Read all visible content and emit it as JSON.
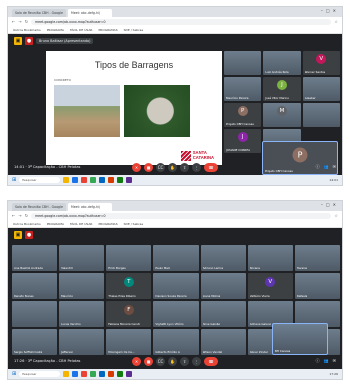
{
  "top": {
    "tabs": [
      "Sala de Reunião CBH - Google",
      "Meet: abc-defg-hij"
    ],
    "url": "meet.google.com/ab-xxxx-mop?authuser=0",
    "bookmarks": [
      "Outros Bookmarks",
      "PROGRAMA",
      "FÁCIL DE USAR",
      "PROGRAMAS",
      "SDE / Sebrae"
    ],
    "meet_header": "Bruno Baltisar (Apresentando)",
    "slide": {
      "title": "Tipos de Barragens",
      "caption": "CONCRETO",
      "brand_line1": "SANTA",
      "brand_line2": "CATARINA"
    },
    "participants": [
      {
        "initial": "",
        "name": "",
        "color": "#5f6368",
        "camera": true
      },
      {
        "initial": "",
        "name": "Luiz Andréa Rola",
        "color": "#5f6368",
        "camera": true
      },
      {
        "initial": "V",
        "name": "Werner Santos",
        "color": "#c2185b",
        "camera": false
      },
      {
        "initial": "",
        "name": "Maurício Pereira",
        "color": "#5f6368",
        "camera": true
      },
      {
        "initial": "J",
        "name": "José Vitor Marino",
        "color": "#7cb342",
        "camera": false
      },
      {
        "initial": "",
        "name": "Gleeber",
        "color": "#5f6368",
        "camera": true
      },
      {
        "initial": "P",
        "name": "Projeto CBH Canoas",
        "color": "#8d6e63",
        "camera": false
      },
      {
        "initial": "M",
        "name": "",
        "color": "#5f6368",
        "camera": true
      },
      {
        "initial": "",
        "name": "",
        "color": "#5f6368",
        "camera": true
      },
      {
        "initial": "J",
        "name": "JOSIANE CORREA",
        "color": "#8e24aa",
        "camera": false
      },
      {
        "initial": "",
        "name": "",
        "color": "#5f6368",
        "camera": true
      }
    ],
    "self_tile": {
      "initial": "P",
      "name": "Projeto CBH Canoas",
      "color": "#8d6e63"
    },
    "footer_time": "14:01 · 3ª Capacitação - CBH Pelotas"
  },
  "bottom": {
    "tabs": [
      "Sala de Reunião CBH - Google",
      "Meet: abc-defg-hij"
    ],
    "url": "meet.google.com/ab-xxxx-mop?authuser=0",
    "bookmarks": [
      "Outros Bookmarks",
      "PROGRAMA",
      "FÁCIL DE USAR",
      "PROGRAMAS",
      "SDE / Sebrae"
    ],
    "participants": [
      {
        "initial": "",
        "name": "Ana Beatriz Andrade",
        "color": "#5f6368",
        "camera": true
      },
      {
        "initial": "",
        "name": "Valentim",
        "color": "#5f6368",
        "camera": true
      },
      {
        "initial": "",
        "name": "Erick Borges",
        "color": "#5f6368",
        "camera": true
      },
      {
        "initial": "",
        "name": "Paulo Melo",
        "color": "#5f6368",
        "camera": true
      },
      {
        "initial": "",
        "name": "Adriano Lemos",
        "color": "#5f6368",
        "camera": true
      },
      {
        "initial": "",
        "name": "Silvana",
        "color": "#5f6368",
        "camera": true
      },
      {
        "initial": "",
        "name": "Tavares",
        "color": "#5f6368",
        "camera": true
      },
      {
        "initial": "",
        "name": "Renato Nunes",
        "color": "#5f6368",
        "camera": true
      },
      {
        "initial": "",
        "name": "Maurício",
        "color": "#5f6368",
        "camera": true
      },
      {
        "initial": "T",
        "name": "Thales Pires Ribeiro",
        "color": "#00897b",
        "camera": false
      },
      {
        "initial": "",
        "name": "Davison Souza Pereira",
        "color": "#5f6368",
        "camera": true
      },
      {
        "initial": "",
        "name": "Joana Molina",
        "color": "#5f6368",
        "camera": true
      },
      {
        "initial": "V",
        "name": "Valtécio Vieira",
        "color": "#5e35b1",
        "camera": false
      },
      {
        "initial": "",
        "name": "Rafaela",
        "color": "#5f6368",
        "camera": true
      },
      {
        "initial": "",
        "name": "",
        "color": "#5f6368",
        "camera": true
      },
      {
        "initial": "",
        "name": "Lucas Vecchio",
        "color": "#5f6368",
        "camera": true
      },
      {
        "initial": "F",
        "name": "Fabiana Moreira Ceruti",
        "color": "#6d4c41",
        "camera": false
      },
      {
        "initial": "",
        "name": "Vighetti Lynn Vitório",
        "color": "#5f6368",
        "camera": true
      },
      {
        "initial": "",
        "name": "Aline Galvão",
        "color": "#5f6368",
        "camera": true
      },
      {
        "initial": "",
        "name": "Adriana Galeno",
        "color": "#5f6368",
        "camera": true
      },
      {
        "initial": "",
        "name": "",
        "color": "#5f6368",
        "camera": true
      },
      {
        "initial": "",
        "name": "Sergio Soffiati Costa",
        "color": "#5f6368",
        "camera": true
      },
      {
        "initial": "",
        "name": "Jefferson",
        "color": "#5f6368",
        "camera": true
      },
      {
        "initial": "",
        "name": "Moxingam Os Ca...",
        "color": "#5f6368",
        "camera": true
      },
      {
        "initial": "",
        "name": "Gilberto Emídio A",
        "color": "#5f6368",
        "camera": true
      },
      {
        "initial": "",
        "name": "Wilson Vendel",
        "color": "#5f6368",
        "camera": true
      },
      {
        "initial": "",
        "name": "Abner Zinder",
        "color": "#5f6368",
        "camera": true
      },
      {
        "initial": "",
        "name": "",
        "color": "#5f6368",
        "camera": true
      }
    ],
    "float_self_name": "BH Canoas",
    "footer_time": "17:26 · 3ª Capacitação - CBH Pelotas"
  },
  "controls": [
    "mic-off",
    "cam-off",
    "captions",
    "raise-hand",
    "present",
    "more",
    "end-call"
  ],
  "taskbar": {
    "search_placeholder": "Pesquisar",
    "apps_colors": [
      "#f4b400",
      "#1a73e8",
      "#ea4335",
      "#34a853",
      "#0067c0",
      "#d83b01",
      "#107c10",
      "#5c2d91"
    ],
    "time_top": "14:01",
    "time_bottom": "17:26"
  }
}
